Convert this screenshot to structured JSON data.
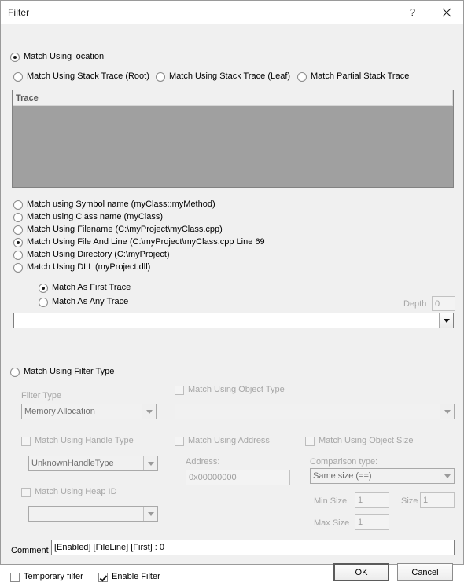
{
  "window": {
    "title": "Filter",
    "help_icon": "question-mark-icon",
    "close_icon": "close-icon"
  },
  "location_section": {
    "match_using_location": {
      "label": "Match Using location",
      "checked": true
    },
    "stack_trace_options": [
      {
        "label": "Match Using Stack Trace (Root)",
        "checked": false
      },
      {
        "label": "Match Using Stack Trace (Leaf)",
        "checked": false
      },
      {
        "label": "Match Partial Stack Trace",
        "checked": false
      }
    ],
    "trace_list": {
      "column_header": "Trace",
      "rows": []
    },
    "match_options": [
      {
        "label": "Match using Symbol name (myClass::myMethod)",
        "checked": false
      },
      {
        "label": "Match using Class name (myClass)",
        "checked": false
      },
      {
        "label": "Match Using Filename (C:\\myProject\\myClass.cpp)",
        "checked": false
      },
      {
        "label": "Match Using File And Line (C:\\myProject\\myClass.cpp Line 69",
        "checked": true
      },
      {
        "label": "Match Using Directory (C:\\myProject)",
        "checked": false
      },
      {
        "label": "Match Using DLL (myProject.dll)",
        "checked": false
      }
    ],
    "trace_mode": [
      {
        "label": "Match As First Trace",
        "checked": true
      },
      {
        "label": "Match As Any Trace",
        "checked": false
      }
    ],
    "depth": {
      "label": "Depth",
      "value": "0",
      "enabled": false
    },
    "location_combo": {
      "value": "",
      "enabled": true
    }
  },
  "filter_type_section": {
    "match_using_filter_type": {
      "label": "Match Using Filter Type",
      "checked": false
    },
    "filter_type": {
      "label": "Filter Type",
      "value": "Memory Allocation",
      "enabled": false
    },
    "match_using_object_type": {
      "label": "Match Using Object Type",
      "checked": false,
      "enabled": false
    },
    "object_type_combo": {
      "value": "",
      "enabled": false
    },
    "match_using_handle_type": {
      "label": "Match Using Handle Type",
      "checked": false,
      "enabled": false
    },
    "handle_type_combo": {
      "value": "UnknownHandleType",
      "enabled": false
    },
    "match_using_address": {
      "label": "Match Using Address",
      "checked": false,
      "enabled": false
    },
    "address": {
      "label": "Address:",
      "value": "0x00000000",
      "enabled": false
    },
    "match_using_object_size": {
      "label": "Match Using Object Size",
      "checked": false,
      "enabled": false
    },
    "comparison_type": {
      "label": "Comparison type:",
      "value": "Same size (==)",
      "enabled": false
    },
    "match_using_heap_id": {
      "label": "Match Using Heap ID",
      "checked": false,
      "enabled": false
    },
    "heap_id_combo": {
      "value": "",
      "enabled": false
    },
    "min_size": {
      "label": "Min Size",
      "value": "1",
      "enabled": false
    },
    "size": {
      "label": "Size",
      "value": "1",
      "enabled": false
    },
    "max_size": {
      "label": "Max Size",
      "value": "1",
      "enabled": false
    }
  },
  "footer": {
    "comment_label": "Comment",
    "comment_value": "[Enabled] [FileLine]  [First]  : 0",
    "temporary_filter": {
      "label": "Temporary filter",
      "checked": false
    },
    "enable_filter": {
      "label": "Enable Filter",
      "checked": true
    },
    "ok_button": "OK",
    "cancel_button": "Cancel"
  },
  "colors": {
    "dialog_background": "#f0f0f0",
    "titlebar_background": "#ffffff",
    "disabled_text": "#a6a6a6",
    "listview_body": "#a0a0a0",
    "border": "#828282"
  }
}
